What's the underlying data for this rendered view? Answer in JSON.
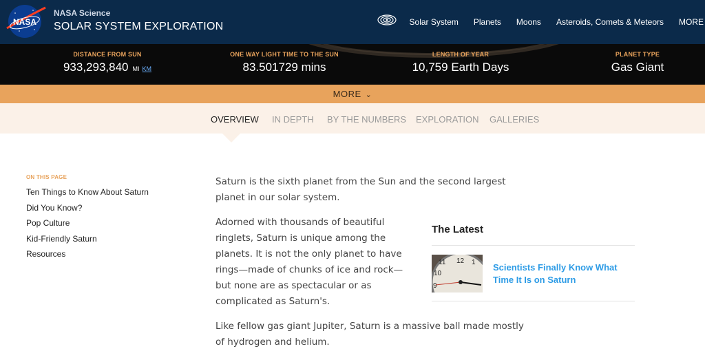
{
  "header": {
    "brand_small": "NASA Science",
    "brand_title": "SOLAR SYSTEM EXPLORATION",
    "nav": [
      "Solar System",
      "Planets",
      "Moons",
      "Asteroids, Comets & Meteors",
      "MORE"
    ]
  },
  "stats": {
    "distance": {
      "label": "DISTANCE FROM SUN",
      "value": "933,293,840",
      "unit_mi": "MI",
      "unit_km": "KM"
    },
    "light_time": {
      "label": "ONE WAY LIGHT TIME TO THE SUN",
      "value": "83.501729 mins"
    },
    "year": {
      "label": "LENGTH OF YEAR",
      "value": "10,759 Earth Days"
    },
    "type": {
      "label": "PLANET TYPE",
      "value": "Gas Giant"
    }
  },
  "more_bar": {
    "label": "MORE"
  },
  "tabs": [
    "OVERVIEW",
    "IN DEPTH",
    "BY THE NUMBERS",
    "EXPLORATION",
    "GALLERIES"
  ],
  "sidebar": {
    "heading": "ON THIS PAGE",
    "items": [
      "Ten Things to Know About Saturn",
      "Did You Know?",
      "Pop Culture",
      "Kid-Friendly Saturn",
      "Resources"
    ]
  },
  "article": {
    "p1": "Saturn is the sixth planet from the Sun and the second largest planet in our solar system.",
    "p2": "Adorned with thousands of beautiful ringlets, Saturn is unique among the planets. It is not the only planet to have rings—made of chunks of ice and rock—but none are as spectacular or as complicated as Saturn's.",
    "p3": "Like fellow gas giant Jupiter, Saturn is a massive ball made mostly of hydrogen and helium."
  },
  "latest": {
    "title": "The Latest",
    "item_title": "Scientists Finally Know What Time It Is on Saturn"
  },
  "colors": {
    "header_bg": "#0b2a4a",
    "accent_orange": "#e8a35c",
    "link_blue": "#2e9ce6",
    "tab_bg": "#fbf1e8"
  }
}
